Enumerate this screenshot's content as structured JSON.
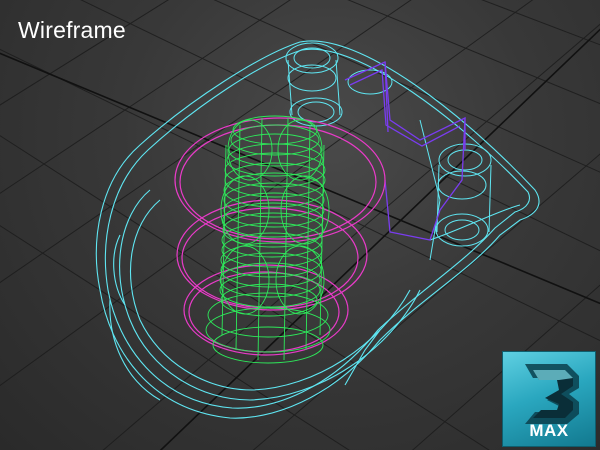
{
  "viewport": {
    "label": "Wireframe",
    "colors": {
      "background": "#333333",
      "grid": "#1a1a1a",
      "outline": "#5fe6f2",
      "coil": "#2ee85a",
      "ring": "#e83bc8",
      "bracket": "#7a3cf0"
    }
  },
  "logo": {
    "text": "MAX",
    "icon": "3ds-max-logo-icon"
  }
}
